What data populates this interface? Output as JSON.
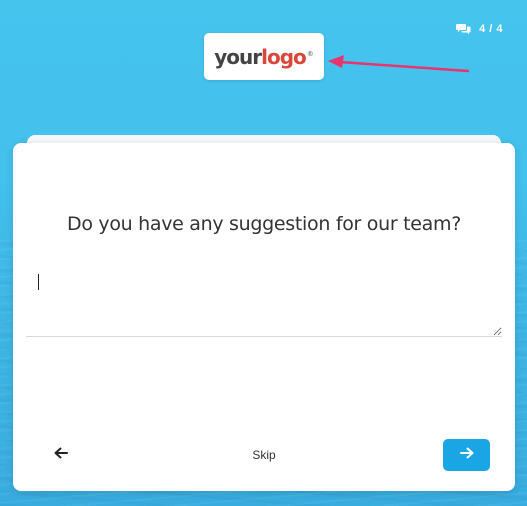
{
  "progress": {
    "icon": "chat-bubbles-icon",
    "text": "4 / 4"
  },
  "logo": {
    "word1": "your",
    "word2": "logo",
    "mark": "®"
  },
  "annotation": {
    "arrow_color": "#e8336f"
  },
  "survey": {
    "question": "Do you have any suggestion for our team?",
    "answer_value": "",
    "skip_label": "Skip",
    "back_icon": "arrow-left-icon",
    "next_icon": "arrow-right-icon"
  },
  "colors": {
    "background": "#45c4ee",
    "accent": "#1aa6e4",
    "card": "#ffffff"
  }
}
